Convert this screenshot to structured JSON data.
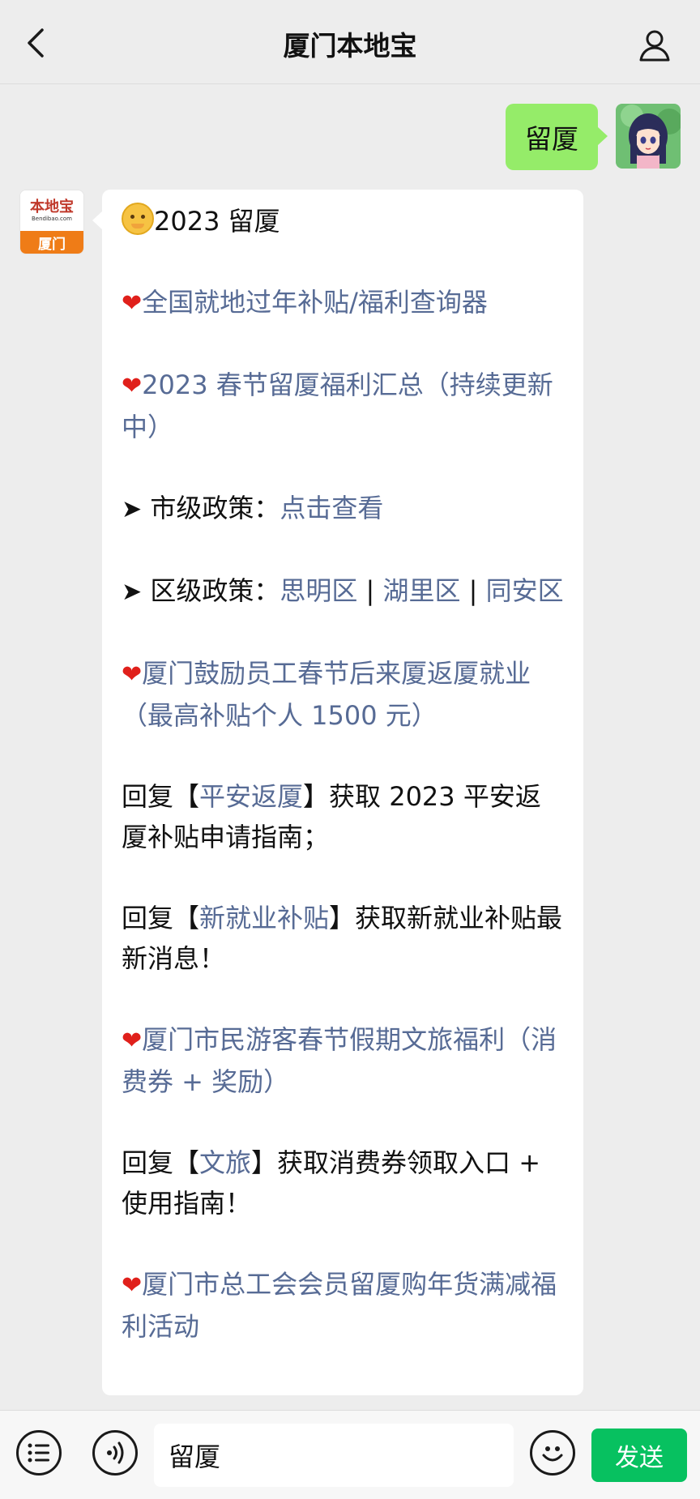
{
  "header": {
    "title": "厦门本地宝",
    "back_icon": "chevron-left-icon",
    "profile_icon": "person-icon"
  },
  "outgoing": {
    "text": "留厦",
    "bubble_color": "#95ec69"
  },
  "account_avatar": {
    "brand": "本地宝",
    "url": "Bendibao.com",
    "city": "厦门",
    "accent": "#ef7c17"
  },
  "reply": {
    "line1": "2023 留厦",
    "item1": "全国就地过年补贴/福利查询器",
    "item2": "2023 春节留厦福利汇总（持续更新中）",
    "city_prefix": "市级政策：",
    "city_link": "点击查看",
    "district_prefix": "区级政策：",
    "district_1": "思明区",
    "district_sep": "|",
    "district_2": "湖里区",
    "district_3": "同安区",
    "item3": "厦门鼓励员工春节后来厦返厦就业（最高补贴个人 1500 元）",
    "reply1_a": "回复【",
    "reply1_link": "平安返厦",
    "reply1_b": "】获取 2023 平安返厦补贴申请指南；",
    "reply2_a": "回复【",
    "reply2_link": "新就业补贴",
    "reply2_b": "】获取新就业补贴最新消息！",
    "item4": "厦门市民游客春节假期文旅福利（消费券 + 奖励）",
    "reply3_a": "回复【",
    "reply3_link": "文旅",
    "reply3_b": "】获取消费券领取入口 + 使用指南！",
    "item5": "厦门市总工会会员留厦购年货满减福利活动",
    "link_color": "#576b95"
  },
  "input_bar": {
    "value": "留厦",
    "send_label": "发送",
    "send_color": "#07c160"
  }
}
